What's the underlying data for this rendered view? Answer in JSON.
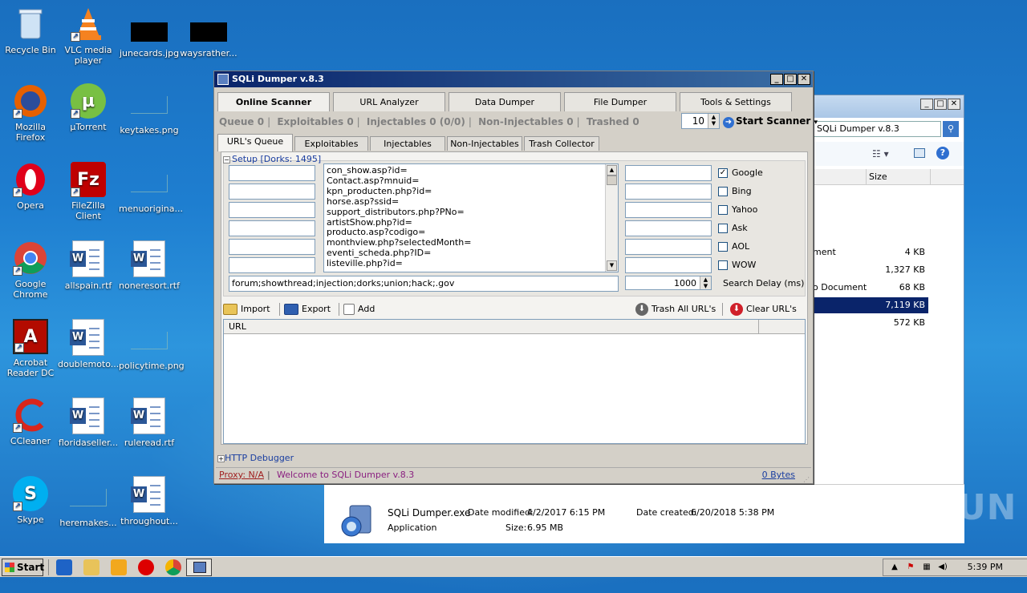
{
  "desktop": {
    "icons": [
      {
        "label": "Recycle Bin"
      },
      {
        "label": "VLC media player"
      },
      {
        "label": "junecards.jpg"
      },
      {
        "label": "waysrather..."
      },
      {
        "label": "Mozilla Firefox"
      },
      {
        "label": "µTorrent"
      },
      {
        "label": "keytakes.png"
      },
      {
        "label": "Opera"
      },
      {
        "label": "FileZilla Client"
      },
      {
        "label": "menuorigina..."
      },
      {
        "label": "Google Chrome"
      },
      {
        "label": "allspain.rtf"
      },
      {
        "label": "noneresort.rtf"
      },
      {
        "label": "Acrobat Reader DC"
      },
      {
        "label": "doublemoto..."
      },
      {
        "label": "policytime.png"
      },
      {
        "label": "CCleaner"
      },
      {
        "label": "floridaseller..."
      },
      {
        "label": "ruleread.rtf"
      },
      {
        "label": "Skype"
      },
      {
        "label": "heremakes..."
      },
      {
        "label": "throughout..."
      }
    ]
  },
  "explorer": {
    "address": "SQLi Dumper v.8.3",
    "column_size": "Size",
    "rows": [
      {
        "name": "ment",
        "size": "4 KB"
      },
      {
        "name": "",
        "size": "1,327 KB"
      },
      {
        "name": "o Document",
        "size": "68 KB"
      },
      {
        "name": "",
        "size": "7,119 KB"
      },
      {
        "name": "",
        "size": "572 KB"
      }
    ],
    "details": {
      "filename": "SQLi Dumper.exe",
      "modified_label": "Date modified:",
      "modified": "4/2/2017 6:15 PM",
      "created_label": "Date created:",
      "created": "6/20/2018 5:38 PM",
      "type": "Application",
      "size_label": "Size:",
      "size": "6.95 MB"
    }
  },
  "app": {
    "title": "SQLi Dumper v.8.3",
    "top_tabs": [
      "Online Scanner",
      "URL Analyzer",
      "Data Dumper",
      "File Dumper",
      "Tools & Settings"
    ],
    "stats": {
      "queue": "Queue 0",
      "exploitables": "Exploitables 0",
      "injectables": "Injectables 0 (0/0)",
      "non_injectables": "Non-Injectables 0",
      "trashed": "Trashed 0"
    },
    "threads": "10",
    "start_scanner": "Start Scanner",
    "sub_tabs": [
      "URL's Queue",
      "Exploitables",
      "Injectables",
      "Non-Injectables",
      "Trash Collector"
    ],
    "setup_label": "Setup [Dorks: 1495]",
    "dorks": [
      "con_show.asp?id=",
      "Contact.asp?mnuid=",
      "kpn_producten.php?id=",
      "horse.asp?ssid=",
      "support_distributors.php?PNo=",
      "artistShow.php?id=",
      "producto.asp?codigo=",
      "monthview.php?selectedMonth=",
      "eventi_scheda.php?ID=",
      "listeville.php?id="
    ],
    "exclude": "forum;showthread;injection;dorks;union;hack;.gov",
    "search_delay_value": "1000",
    "search_delay_label": "Search Delay (ms)",
    "engines": [
      {
        "label": "Google",
        "checked": true
      },
      {
        "label": "Bing",
        "checked": false
      },
      {
        "label": "Yahoo",
        "checked": false
      },
      {
        "label": "Ask",
        "checked": false
      },
      {
        "label": "AOL",
        "checked": false
      },
      {
        "label": "WOW",
        "checked": false
      }
    ],
    "toolbar": {
      "import": "Import",
      "export": "Export",
      "add": "Add",
      "trash_all": "Trash All URL's",
      "clear": "Clear URL's"
    },
    "url_column": "URL",
    "http_debugger": "HTTP Debugger",
    "status": {
      "proxy": "Proxy: N/A",
      "separator": "|",
      "welcome": "Welcome to SQLi Dumper v.8.3",
      "bytes": "0 Bytes"
    }
  },
  "taskbar": {
    "start": "Start",
    "clock": "5:39 PM"
  },
  "watermark": "ANY RUN",
  "colors": {
    "title_active": "#0a246a",
    "setup_blue": "#1a3ea0",
    "proxy_red": "#a02020"
  }
}
